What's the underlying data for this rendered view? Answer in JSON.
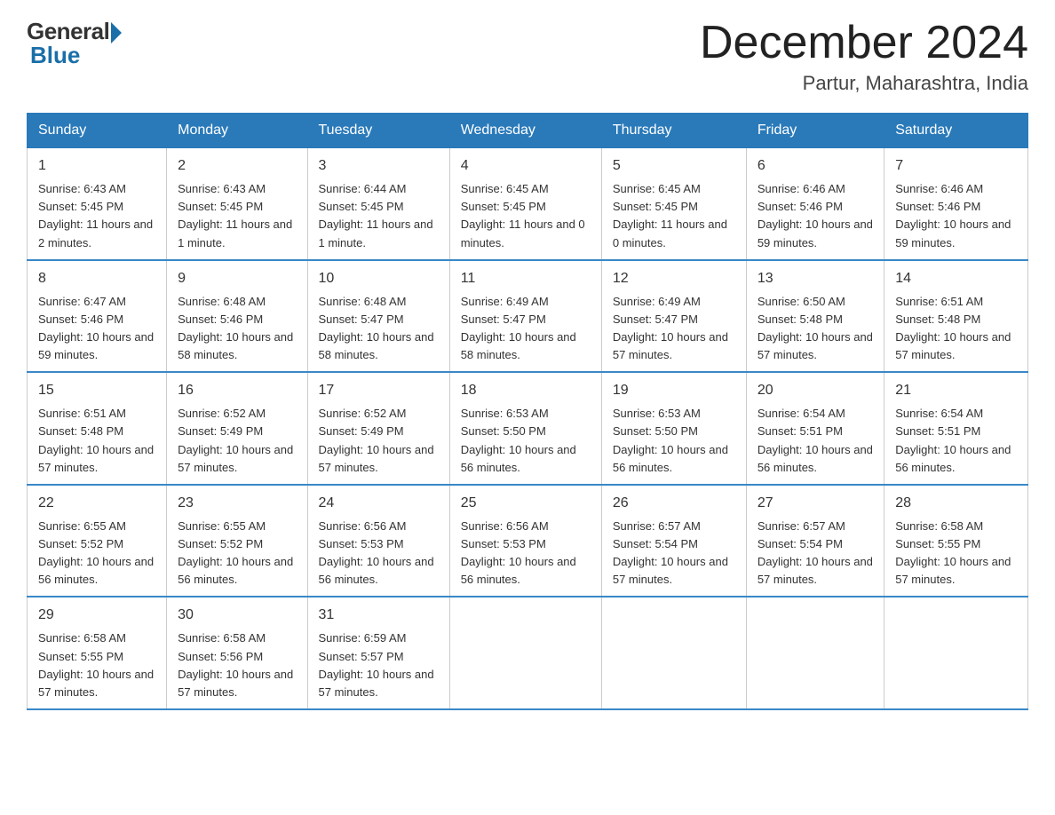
{
  "logo": {
    "general": "General",
    "blue": "Blue"
  },
  "title": "December 2024",
  "subtitle": "Partur, Maharashtra, India",
  "headers": [
    "Sunday",
    "Monday",
    "Tuesday",
    "Wednesday",
    "Thursday",
    "Friday",
    "Saturday"
  ],
  "weeks": [
    [
      {
        "day": "1",
        "sunrise": "6:43 AM",
        "sunset": "5:45 PM",
        "daylight": "11 hours and 2 minutes."
      },
      {
        "day": "2",
        "sunrise": "6:43 AM",
        "sunset": "5:45 PM",
        "daylight": "11 hours and 1 minute."
      },
      {
        "day": "3",
        "sunrise": "6:44 AM",
        "sunset": "5:45 PM",
        "daylight": "11 hours and 1 minute."
      },
      {
        "day": "4",
        "sunrise": "6:45 AM",
        "sunset": "5:45 PM",
        "daylight": "11 hours and 0 minutes."
      },
      {
        "day": "5",
        "sunrise": "6:45 AM",
        "sunset": "5:45 PM",
        "daylight": "11 hours and 0 minutes."
      },
      {
        "day": "6",
        "sunrise": "6:46 AM",
        "sunset": "5:46 PM",
        "daylight": "10 hours and 59 minutes."
      },
      {
        "day": "7",
        "sunrise": "6:46 AM",
        "sunset": "5:46 PM",
        "daylight": "10 hours and 59 minutes."
      }
    ],
    [
      {
        "day": "8",
        "sunrise": "6:47 AM",
        "sunset": "5:46 PM",
        "daylight": "10 hours and 59 minutes."
      },
      {
        "day": "9",
        "sunrise": "6:48 AM",
        "sunset": "5:46 PM",
        "daylight": "10 hours and 58 minutes."
      },
      {
        "day": "10",
        "sunrise": "6:48 AM",
        "sunset": "5:47 PM",
        "daylight": "10 hours and 58 minutes."
      },
      {
        "day": "11",
        "sunrise": "6:49 AM",
        "sunset": "5:47 PM",
        "daylight": "10 hours and 58 minutes."
      },
      {
        "day": "12",
        "sunrise": "6:49 AM",
        "sunset": "5:47 PM",
        "daylight": "10 hours and 57 minutes."
      },
      {
        "day": "13",
        "sunrise": "6:50 AM",
        "sunset": "5:48 PM",
        "daylight": "10 hours and 57 minutes."
      },
      {
        "day": "14",
        "sunrise": "6:51 AM",
        "sunset": "5:48 PM",
        "daylight": "10 hours and 57 minutes."
      }
    ],
    [
      {
        "day": "15",
        "sunrise": "6:51 AM",
        "sunset": "5:48 PM",
        "daylight": "10 hours and 57 minutes."
      },
      {
        "day": "16",
        "sunrise": "6:52 AM",
        "sunset": "5:49 PM",
        "daylight": "10 hours and 57 minutes."
      },
      {
        "day": "17",
        "sunrise": "6:52 AM",
        "sunset": "5:49 PM",
        "daylight": "10 hours and 57 minutes."
      },
      {
        "day": "18",
        "sunrise": "6:53 AM",
        "sunset": "5:50 PM",
        "daylight": "10 hours and 56 minutes."
      },
      {
        "day": "19",
        "sunrise": "6:53 AM",
        "sunset": "5:50 PM",
        "daylight": "10 hours and 56 minutes."
      },
      {
        "day": "20",
        "sunrise": "6:54 AM",
        "sunset": "5:51 PM",
        "daylight": "10 hours and 56 minutes."
      },
      {
        "day": "21",
        "sunrise": "6:54 AM",
        "sunset": "5:51 PM",
        "daylight": "10 hours and 56 minutes."
      }
    ],
    [
      {
        "day": "22",
        "sunrise": "6:55 AM",
        "sunset": "5:52 PM",
        "daylight": "10 hours and 56 minutes."
      },
      {
        "day": "23",
        "sunrise": "6:55 AM",
        "sunset": "5:52 PM",
        "daylight": "10 hours and 56 minutes."
      },
      {
        "day": "24",
        "sunrise": "6:56 AM",
        "sunset": "5:53 PM",
        "daylight": "10 hours and 56 minutes."
      },
      {
        "day": "25",
        "sunrise": "6:56 AM",
        "sunset": "5:53 PM",
        "daylight": "10 hours and 56 minutes."
      },
      {
        "day": "26",
        "sunrise": "6:57 AM",
        "sunset": "5:54 PM",
        "daylight": "10 hours and 57 minutes."
      },
      {
        "day": "27",
        "sunrise": "6:57 AM",
        "sunset": "5:54 PM",
        "daylight": "10 hours and 57 minutes."
      },
      {
        "day": "28",
        "sunrise": "6:58 AM",
        "sunset": "5:55 PM",
        "daylight": "10 hours and 57 minutes."
      }
    ],
    [
      {
        "day": "29",
        "sunrise": "6:58 AM",
        "sunset": "5:55 PM",
        "daylight": "10 hours and 57 minutes."
      },
      {
        "day": "30",
        "sunrise": "6:58 AM",
        "sunset": "5:56 PM",
        "daylight": "10 hours and 57 minutes."
      },
      {
        "day": "31",
        "sunrise": "6:59 AM",
        "sunset": "5:57 PM",
        "daylight": "10 hours and 57 minutes."
      },
      null,
      null,
      null,
      null
    ]
  ]
}
